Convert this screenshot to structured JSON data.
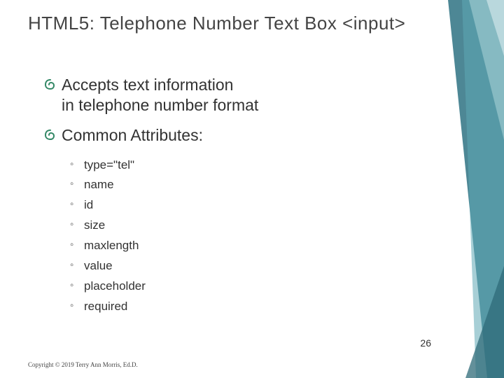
{
  "title": "HTML5: Telephone Number Text Box <input>",
  "bullets": [
    {
      "line1": "Accepts text information",
      "line2": "in telephone number format"
    },
    {
      "line1": "Common Attributes:",
      "line2": ""
    }
  ],
  "attributes": [
    "type=\"tel\"",
    "name",
    "id",
    "size",
    "maxlength",
    "value",
    "placeholder",
    "required"
  ],
  "pageNumber": "26",
  "copyright": "Copyright © 2019 Terry Ann Morris, Ed.D."
}
